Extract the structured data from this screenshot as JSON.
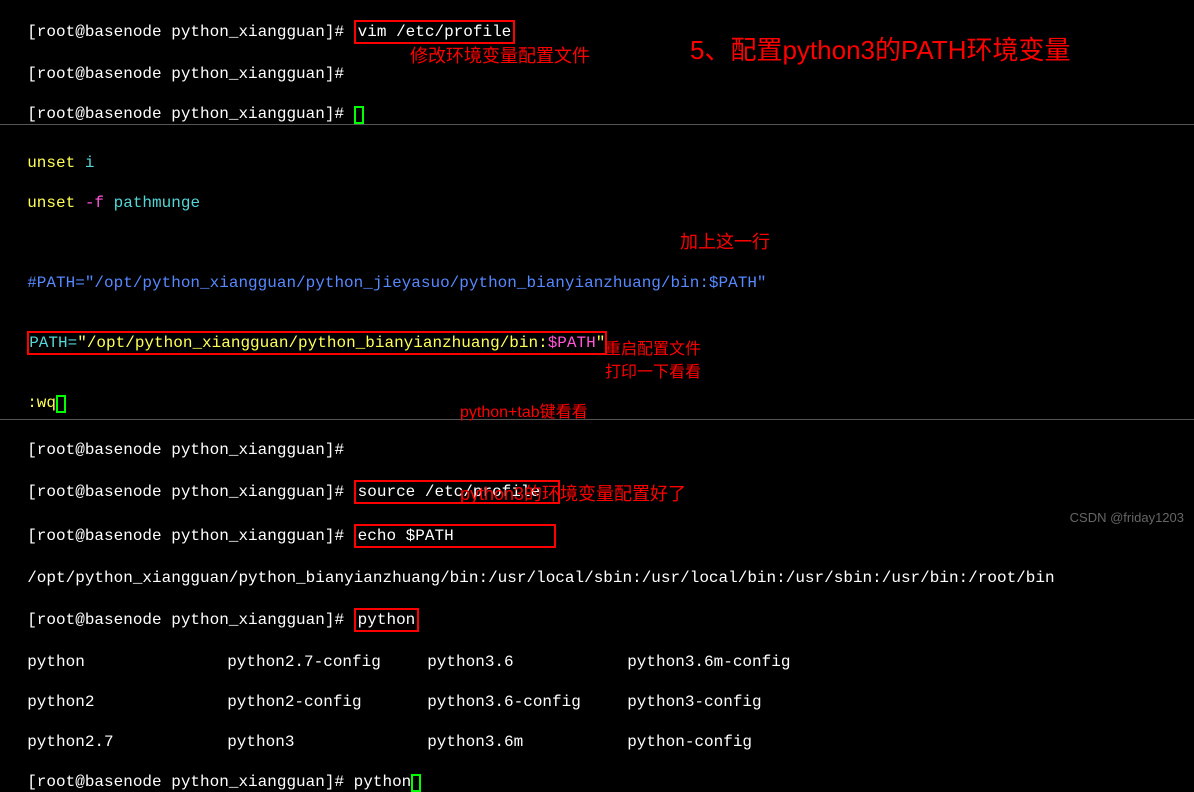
{
  "title_annotation": "5、配置python3的PATH环境变量",
  "annotation_modify": "修改环境变量配置文件",
  "annotation_add_line": "加上这一行",
  "annotation_restart": "重启配置文件",
  "annotation_print": "打印一下看看",
  "annotation_tab": "python+tab键看看",
  "annotation_done": "python3的环境变量配置好了",
  "watermark": "CSDN @friday1203",
  "prompt": "[root@basenode python_xiangguan]# ",
  "cmd_vim": "vim /etc/profile",
  "cmd_source": "source /etc/profile",
  "cmd_echo": "echo $PATH",
  "cmd_python": "python",
  "unset_i": "unset i",
  "unset_f": "unset -f pathmunge",
  "path_comment": "#PATH=\"/opt/python_xiangguan/python_jieyasuo/python_bianyianzhuang/bin:$PATH\"",
  "path_var": "PATH=",
  "path_value": "\"/opt/python_xiangguan/python_bianyianzhuang/bin:$PATH\"",
  "path_value_head": "\"/opt/python_xiangguan/python_bianyianzhuang/bin:",
  "path_dollar": "$PATH",
  "path_tail": "\"",
  "wq": ":wq",
  "path_output": "/opt/python_xiangguan/python_bianyianzhuang/bin:/usr/local/sbin:/usr/local/bin:/usr/sbin:/usr/bin:/root/bin",
  "cols": {
    "r1c1": "python",
    "r1c2": "python2.7-config",
    "r1c3": "python3.6",
    "r1c4": "python3.6m-config",
    "r2c1": "python2",
    "r2c2": "python2-config",
    "r2c3": "python3.6-config",
    "r2c4": "python3-config",
    "r3c1": "python2.7",
    "r3c2": "python3",
    "r3c3": "python3.6m",
    "r3c4": "python-config"
  }
}
